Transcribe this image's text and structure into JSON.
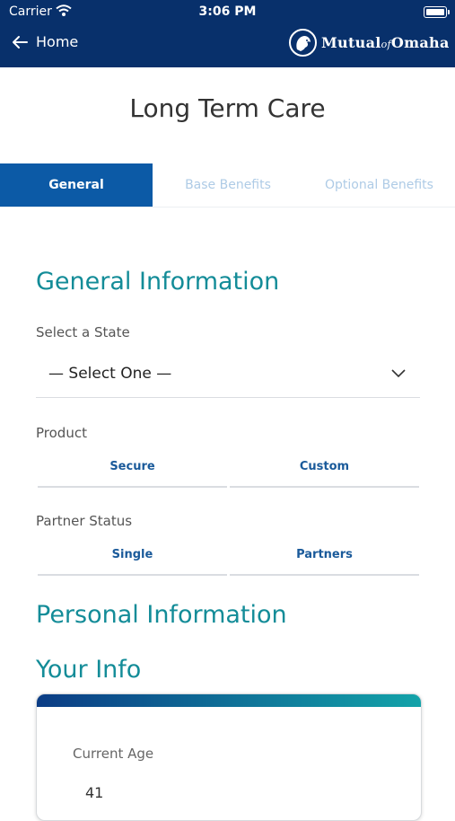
{
  "status_bar": {
    "carrier": "Carrier",
    "time": "3:06 PM"
  },
  "nav": {
    "back_label": "Home",
    "logo_text_pre": "Mutual",
    "logo_text_of": "of",
    "logo_text_post": "Omaha"
  },
  "page": {
    "title": "Long Term Care"
  },
  "tabs": [
    {
      "label": "General",
      "active": true
    },
    {
      "label": "Base Benefits",
      "active": false
    },
    {
      "label": "Optional Benefits",
      "active": false
    }
  ],
  "general_info": {
    "heading": "General Information",
    "state_label": "Select a State",
    "state_value": "— Select One —",
    "product_label": "Product",
    "product_options": [
      "Secure",
      "Custom"
    ],
    "partner_label": "Partner Status",
    "partner_options": [
      "Single",
      "Partners"
    ]
  },
  "personal_info": {
    "heading": "Personal Information",
    "subheading": "Your Info",
    "age_label": "Current Age",
    "age_value": "41"
  },
  "colors": {
    "nav_bg": "#08306b",
    "active_tab": "#0c5aa6",
    "heading": "#138c98",
    "segment_text": "#1a5a9a"
  }
}
